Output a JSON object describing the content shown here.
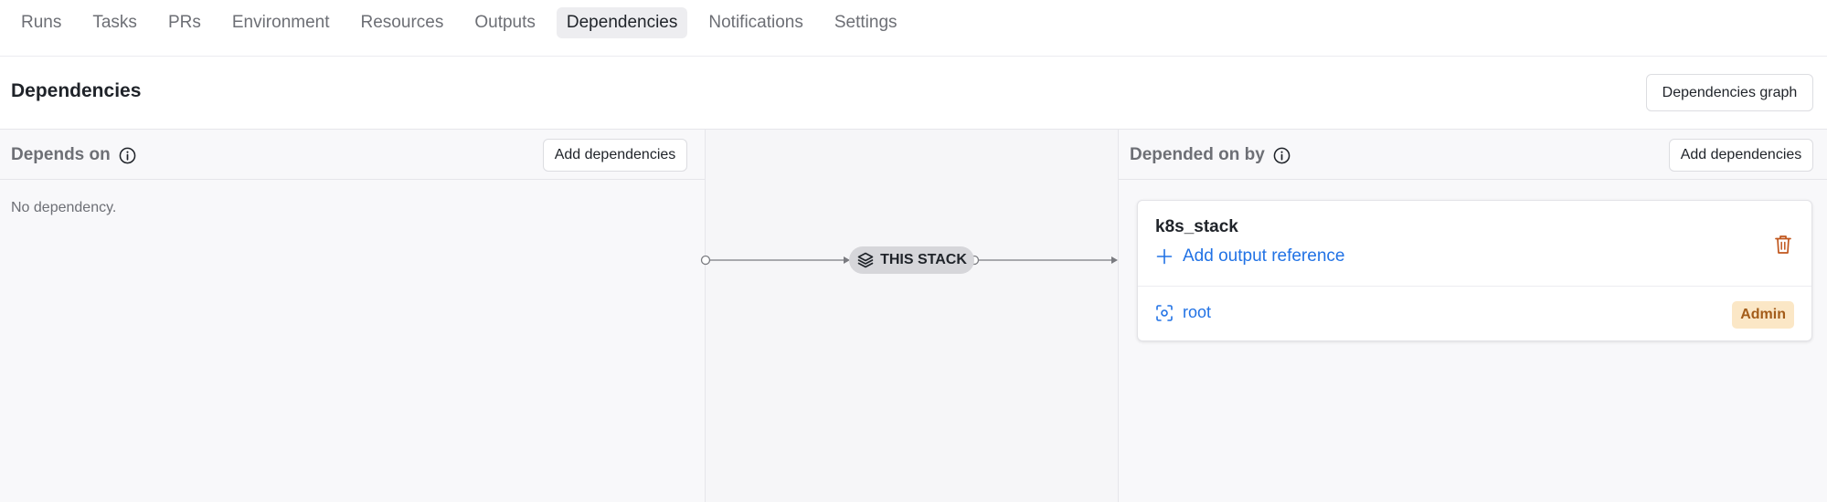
{
  "tabs": [
    {
      "label": "Runs"
    },
    {
      "label": "Tasks"
    },
    {
      "label": "PRs"
    },
    {
      "label": "Environment"
    },
    {
      "label": "Resources"
    },
    {
      "label": "Outputs"
    },
    {
      "label": "Dependencies",
      "active": true
    },
    {
      "label": "Notifications"
    },
    {
      "label": "Settings"
    }
  ],
  "header": {
    "title": "Dependencies",
    "graph_button": "Dependencies graph"
  },
  "depends_on": {
    "title": "Depends on",
    "add_button": "Add dependencies",
    "empty_text": "No dependency."
  },
  "diagram": {
    "stack_label": "THIS STACK"
  },
  "depended_on_by": {
    "title": "Depended on by",
    "add_button": "Add dependencies",
    "items": [
      {
        "name": "k8s_stack",
        "add_output_label": "Add output reference",
        "space": "root",
        "role": "Admin"
      }
    ]
  },
  "colors": {
    "link": "#2172e5",
    "badge_bg": "#fbe7c6",
    "badge_text": "#a35c19",
    "trash": "#c0561c"
  }
}
